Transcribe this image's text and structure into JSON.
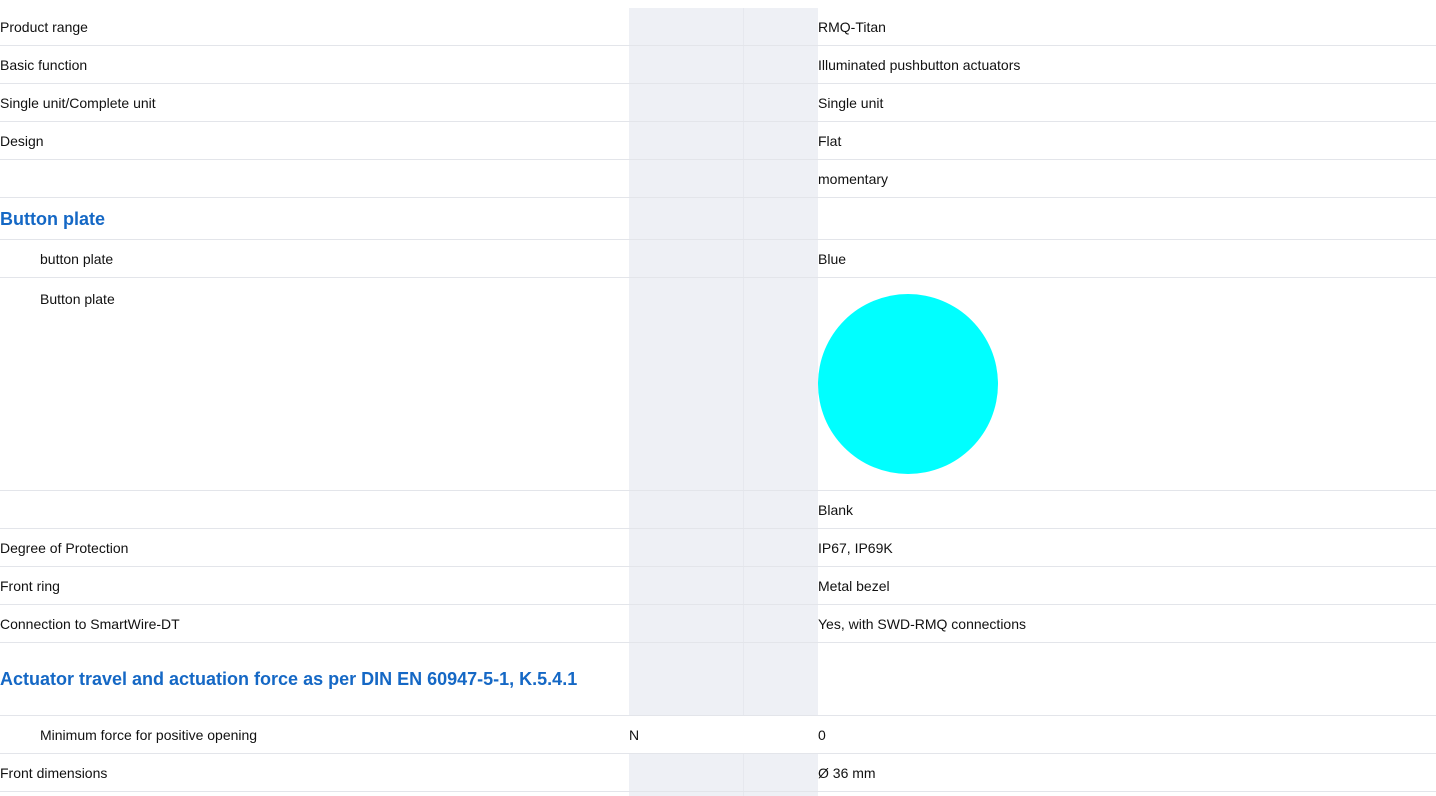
{
  "rows": [
    {
      "label": "Product range",
      "unit": "",
      "value": "RMQ-Titan"
    },
    {
      "label": "Basic function",
      "unit": "",
      "value": "Illuminated pushbutton actuators"
    },
    {
      "label": "Single unit/Complete unit",
      "unit": "",
      "value": "Single unit"
    },
    {
      "label": "Design",
      "unit": "",
      "value": "Flat"
    },
    {
      "label": "",
      "unit": "",
      "value": "momentary"
    }
  ],
  "section_button_plate": {
    "title": "Button plate",
    "color_label": "button plate",
    "color_value": "Blue",
    "image_label": "Button plate",
    "swatch_color": "#00ffff"
  },
  "rows2": [
    {
      "label": "",
      "unit": "",
      "value": "Blank"
    },
    {
      "label": "Degree of Protection",
      "unit": "",
      "value": "IP67, IP69K"
    },
    {
      "label": "Front ring",
      "unit": "",
      "value": "Metal bezel"
    },
    {
      "label": "Connection to SmartWire-DT",
      "unit": "",
      "value": "Yes, with SWD-RMQ connections"
    }
  ],
  "section_actuator": {
    "title": "Actuator travel and actuation force as per DIN EN 60947-5-1, K.5.4.1",
    "force_label": "Minimum force for positive opening",
    "force_unit": "N",
    "force_value": "0"
  },
  "front_dimensions": {
    "label": "Front dimensions",
    "value": "Ø 36 mm"
  }
}
